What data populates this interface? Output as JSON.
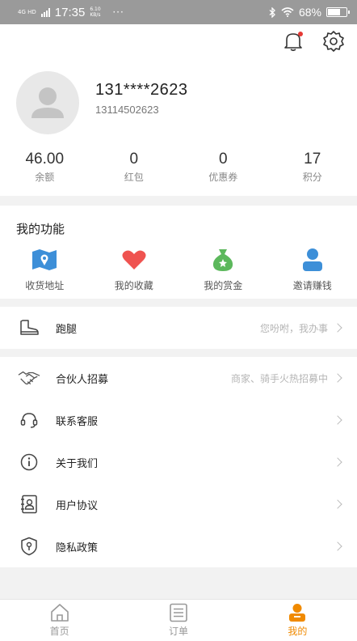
{
  "status_bar": {
    "network_label": "4G HD",
    "time": "17:35",
    "speed": "6.10 KB/s",
    "more": "···",
    "battery": "68%",
    "battery_level": 0.68
  },
  "header": {
    "phone_masked": "131****2623",
    "phone_full": "13114502623",
    "stats": [
      {
        "value": "46.00",
        "label": "余额"
      },
      {
        "value": "0",
        "label": "红包"
      },
      {
        "value": "0",
        "label": "优惠券"
      },
      {
        "value": "17",
        "label": "积分"
      }
    ]
  },
  "functions": {
    "title": "我的功能",
    "items": [
      {
        "label": "收货地址",
        "icon": "map-icon",
        "color": "#3d8fd8"
      },
      {
        "label": "我的收藏",
        "icon": "heart-icon",
        "color": "#ef5350"
      },
      {
        "label": "我的赏金",
        "icon": "money-bag-icon",
        "color": "#5cb85c"
      },
      {
        "label": "邀请赚钱",
        "icon": "user-icon",
        "color": "#3d8fd8"
      }
    ]
  },
  "errand": {
    "label": "跑腿",
    "hint": "您吩咐，我办事"
  },
  "menu": [
    {
      "label": "合伙人招募",
      "hint": "商家、骑手火热招募中"
    },
    {
      "label": "联系客服",
      "hint": ""
    },
    {
      "label": "关于我们",
      "hint": ""
    },
    {
      "label": "用户协议",
      "hint": ""
    },
    {
      "label": "隐私政策",
      "hint": ""
    }
  ],
  "tabbar": {
    "tabs": [
      {
        "label": "首页",
        "icon": "home-icon"
      },
      {
        "label": "订单",
        "icon": "list-icon"
      },
      {
        "label": "我的",
        "icon": "profile-icon"
      }
    ],
    "active": "我的",
    "accent": "#f08a00"
  }
}
